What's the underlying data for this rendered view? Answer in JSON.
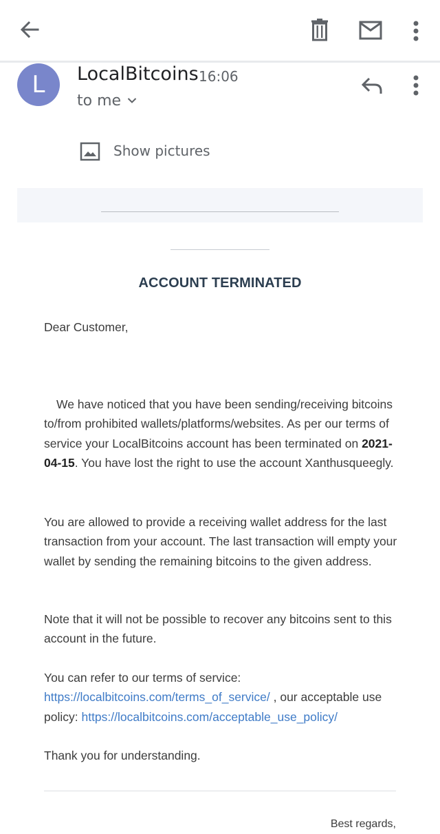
{
  "toolbar": {
    "back_icon": "arrow-left-icon",
    "delete_icon": "trash-icon",
    "mark_unread_icon": "mail-icon",
    "overflow_icon": "more-vert-icon"
  },
  "header": {
    "avatar_letter": "L",
    "avatar_color": "#7986cb",
    "sender": "LocalBitcoins",
    "time": "16:06",
    "recipient": "to me",
    "reply_icon": "reply-icon",
    "overflow_icon": "more-vert-icon"
  },
  "show_pictures": {
    "label": "Show pictures",
    "icon": "image-icon"
  },
  "email": {
    "heading": "ACCOUNT TERMINATED",
    "greeting": "Dear Customer,",
    "p1_before": "We have noticed that you have been sending/receiving bitcoins to/from prohibited wallets/platforms/websites. As per our terms of service your LocalBitcoins account has been terminated on ",
    "p1_date": "2021-04-15",
    "p1_after": ". You have lost the right to use the account Xanthusqueegly.",
    "p2": "You are allowed to provide a receiving wallet address for the last transaction from your account. The last transaction will empty your wallet by sending the remaining bitcoins to the given address.",
    "p3": "Note that it will not be possible to recover any bitcoins sent to this account in the future.",
    "p4_intro": "You can refer to our terms of service:",
    "tos_link": "https://localbitcoins.com/terms_of_service/",
    "p4_mid": " , our acceptable use policy: ",
    "aup_link": "https://localbitcoins.com/acceptable_use_policy/",
    "thanks": "Thank you for understanding.",
    "signoff": "Best regards,",
    "link_color": "#3f7bc7",
    "heading_color": "#2c3e50"
  }
}
